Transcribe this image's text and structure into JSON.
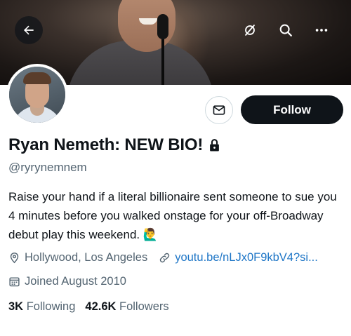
{
  "header": {
    "back_icon": "arrow-left-icon",
    "icons": [
      "eye-slash-icon",
      "search-icon",
      "more-icon"
    ]
  },
  "profile": {
    "name": "Ryan Nemeth: NEW BIO!",
    "lock_icon": "lock-icon",
    "handle": "@ryrynemnem",
    "bio": "Raise your hand if a literal billionaire sent someone to sue you 4 minutes before you walked onstage for your off-Broadway debut play this weekend.",
    "bio_emoji": "🙋‍♂️",
    "location": "Hollywood, Los Angeles",
    "website": "youtu.be/nLJx0F9kbV4?si...",
    "joined": "Joined August 2010",
    "following_count": "3K",
    "following_label": "Following",
    "followers_count": "42.6K",
    "followers_label": "Followers"
  },
  "actions": {
    "message_icon": "envelope-icon",
    "follow_label": "Follow"
  },
  "colors": {
    "primary_text": "#0f1419",
    "secondary_text": "#536471",
    "link": "#1d75c6",
    "follow_bg": "#0f1419"
  }
}
